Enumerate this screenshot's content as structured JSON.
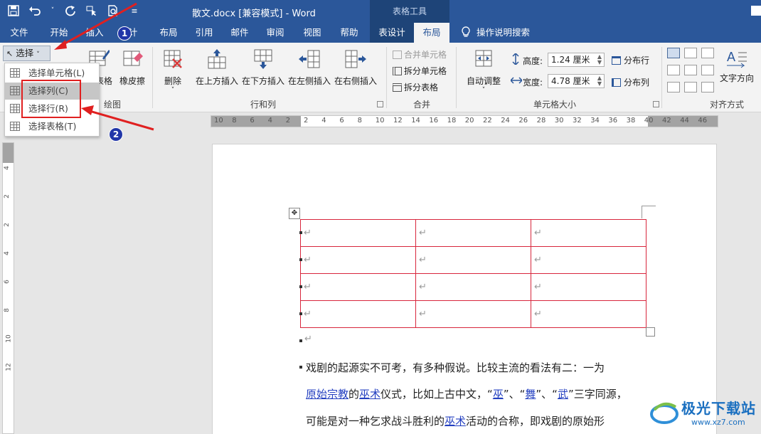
{
  "titlebar": {
    "doc_title": "散文.docx [兼容模式] - Word",
    "context_header": "表格工具"
  },
  "tabs": [
    {
      "label": "文件"
    },
    {
      "label": "开始"
    },
    {
      "label": "插入"
    },
    {
      "label": "计"
    },
    {
      "label": "布局"
    },
    {
      "label": "引用"
    },
    {
      "label": "邮件"
    },
    {
      "label": "审阅"
    },
    {
      "label": "视图"
    },
    {
      "label": "帮助"
    },
    {
      "label": "表设计"
    },
    {
      "label": "布局"
    }
  ],
  "tell_me": "操作说明搜索",
  "ribbon": {
    "select_label": "选择",
    "draw_table": "表格",
    "eraser": "橡皮擦",
    "draw_group": "绘图",
    "delete": "删除",
    "insert_above": "在上方插入",
    "insert_below": "在下方插入",
    "insert_left": "在左侧插入",
    "insert_right": "在右侧插入",
    "rows_cols_group": "行和列",
    "merge_cells": "合并单元格",
    "split_cells": "拆分单元格",
    "split_table": "拆分表格",
    "merge_group": "合并",
    "autofit": "自动调整",
    "height_label": "高度:",
    "height_value": "1.24 厘米",
    "width_label": "宽度:",
    "width_value": "4.78 厘米",
    "distribute_rows": "分布行",
    "distribute_cols": "分布列",
    "cell_size_group": "单元格大小",
    "text_direction": "文字方向",
    "alignment_group": "对齐方式"
  },
  "dropdown": {
    "items": [
      {
        "label": "选择单元格(L)"
      },
      {
        "label": "选择列(C)"
      },
      {
        "label": "选择行(R)"
      },
      {
        "label": "选择表格(T)"
      }
    ]
  },
  "ruler": {
    "h_numbers": [
      "10",
      "8",
      "6",
      "4",
      "2",
      "2",
      "4",
      "6",
      "8",
      "10",
      "12",
      "14",
      "16",
      "18",
      "20",
      "22",
      "24",
      "26",
      "28",
      "30",
      "32",
      "34",
      "36",
      "38",
      "40",
      "42",
      "44",
      "46"
    ],
    "v_numbers": [
      "4",
      "2",
      "2",
      "4",
      "6",
      "8",
      "10",
      "12"
    ]
  },
  "document": {
    "line1": "戏剧的起源实不可考，有多种假说。比较主流的看法有二：一为",
    "line2_link1": "原始宗教",
    "line2_a": "的",
    "line2_link2": "巫术",
    "line2_b": "仪式，比如上古中文，“",
    "line2_link3": "巫",
    "line2_c": "”、“",
    "line2_link4": "舞",
    "line2_d": "”、“",
    "line2_link5": "武",
    "line2_e": "”三字同源，",
    "line3_a": "可能是对一种乞求战斗胜利的",
    "line3_link": "巫术",
    "line3_b": "活动的合称，即戏剧的原始形"
  },
  "annotations": {
    "badge1": "1",
    "badge2": "2"
  },
  "watermark": {
    "text": "极光下载站",
    "url": "www.xz7.com"
  },
  "colors": {
    "word_blue": "#2b579a",
    "annotation_red": "#e02020",
    "table_border": "#d8263c"
  }
}
